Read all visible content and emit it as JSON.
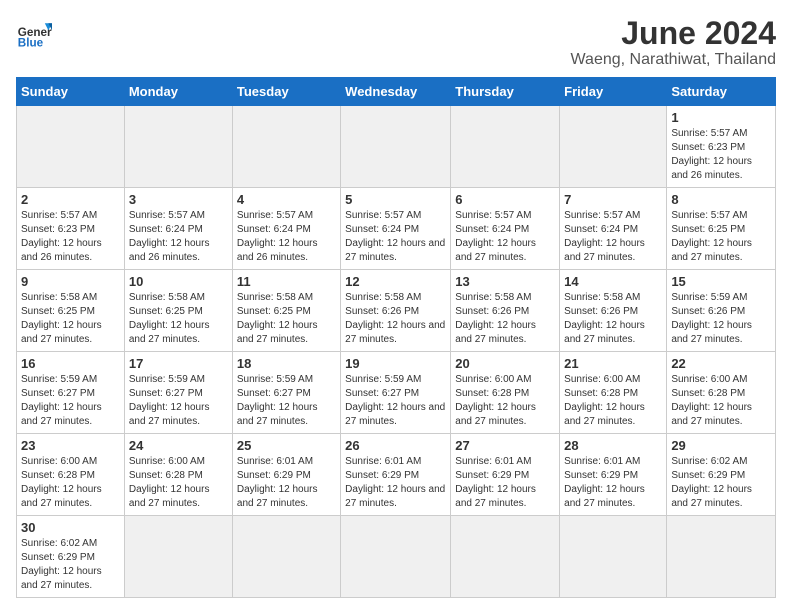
{
  "header": {
    "logo_general": "General",
    "logo_blue": "Blue",
    "title": "June 2024",
    "subtitle": "Waeng, Narathiwat, Thailand"
  },
  "weekdays": [
    "Sunday",
    "Monday",
    "Tuesday",
    "Wednesday",
    "Thursday",
    "Friday",
    "Saturday"
  ],
  "weeks": [
    [
      {
        "date": "",
        "info": ""
      },
      {
        "date": "",
        "info": ""
      },
      {
        "date": "",
        "info": ""
      },
      {
        "date": "",
        "info": ""
      },
      {
        "date": "",
        "info": ""
      },
      {
        "date": "",
        "info": ""
      },
      {
        "date": "1",
        "info": "Sunrise: 5:57 AM\nSunset: 6:23 PM\nDaylight: 12 hours and 26 minutes."
      }
    ],
    [
      {
        "date": "2",
        "info": "Sunrise: 5:57 AM\nSunset: 6:23 PM\nDaylight: 12 hours and 26 minutes."
      },
      {
        "date": "3",
        "info": "Sunrise: 5:57 AM\nSunset: 6:24 PM\nDaylight: 12 hours and 26 minutes."
      },
      {
        "date": "4",
        "info": "Sunrise: 5:57 AM\nSunset: 6:24 PM\nDaylight: 12 hours and 26 minutes."
      },
      {
        "date": "5",
        "info": "Sunrise: 5:57 AM\nSunset: 6:24 PM\nDaylight: 12 hours and 27 minutes."
      },
      {
        "date": "6",
        "info": "Sunrise: 5:57 AM\nSunset: 6:24 PM\nDaylight: 12 hours and 27 minutes."
      },
      {
        "date": "7",
        "info": "Sunrise: 5:57 AM\nSunset: 6:24 PM\nDaylight: 12 hours and 27 minutes."
      },
      {
        "date": "8",
        "info": "Sunrise: 5:57 AM\nSunset: 6:25 PM\nDaylight: 12 hours and 27 minutes."
      }
    ],
    [
      {
        "date": "9",
        "info": "Sunrise: 5:58 AM\nSunset: 6:25 PM\nDaylight: 12 hours and 27 minutes."
      },
      {
        "date": "10",
        "info": "Sunrise: 5:58 AM\nSunset: 6:25 PM\nDaylight: 12 hours and 27 minutes."
      },
      {
        "date": "11",
        "info": "Sunrise: 5:58 AM\nSunset: 6:25 PM\nDaylight: 12 hours and 27 minutes."
      },
      {
        "date": "12",
        "info": "Sunrise: 5:58 AM\nSunset: 6:26 PM\nDaylight: 12 hours and 27 minutes."
      },
      {
        "date": "13",
        "info": "Sunrise: 5:58 AM\nSunset: 6:26 PM\nDaylight: 12 hours and 27 minutes."
      },
      {
        "date": "14",
        "info": "Sunrise: 5:58 AM\nSunset: 6:26 PM\nDaylight: 12 hours and 27 minutes."
      },
      {
        "date": "15",
        "info": "Sunrise: 5:59 AM\nSunset: 6:26 PM\nDaylight: 12 hours and 27 minutes."
      }
    ],
    [
      {
        "date": "16",
        "info": "Sunrise: 5:59 AM\nSunset: 6:27 PM\nDaylight: 12 hours and 27 minutes."
      },
      {
        "date": "17",
        "info": "Sunrise: 5:59 AM\nSunset: 6:27 PM\nDaylight: 12 hours and 27 minutes."
      },
      {
        "date": "18",
        "info": "Sunrise: 5:59 AM\nSunset: 6:27 PM\nDaylight: 12 hours and 27 minutes."
      },
      {
        "date": "19",
        "info": "Sunrise: 5:59 AM\nSunset: 6:27 PM\nDaylight: 12 hours and 27 minutes."
      },
      {
        "date": "20",
        "info": "Sunrise: 6:00 AM\nSunset: 6:28 PM\nDaylight: 12 hours and 27 minutes."
      },
      {
        "date": "21",
        "info": "Sunrise: 6:00 AM\nSunset: 6:28 PM\nDaylight: 12 hours and 27 minutes."
      },
      {
        "date": "22",
        "info": "Sunrise: 6:00 AM\nSunset: 6:28 PM\nDaylight: 12 hours and 27 minutes."
      }
    ],
    [
      {
        "date": "23",
        "info": "Sunrise: 6:00 AM\nSunset: 6:28 PM\nDaylight: 12 hours and 27 minutes."
      },
      {
        "date": "24",
        "info": "Sunrise: 6:00 AM\nSunset: 6:28 PM\nDaylight: 12 hours and 27 minutes."
      },
      {
        "date": "25",
        "info": "Sunrise: 6:01 AM\nSunset: 6:29 PM\nDaylight: 12 hours and 27 minutes."
      },
      {
        "date": "26",
        "info": "Sunrise: 6:01 AM\nSunset: 6:29 PM\nDaylight: 12 hours and 27 minutes."
      },
      {
        "date": "27",
        "info": "Sunrise: 6:01 AM\nSunset: 6:29 PM\nDaylight: 12 hours and 27 minutes."
      },
      {
        "date": "28",
        "info": "Sunrise: 6:01 AM\nSunset: 6:29 PM\nDaylight: 12 hours and 27 minutes."
      },
      {
        "date": "29",
        "info": "Sunrise: 6:02 AM\nSunset: 6:29 PM\nDaylight: 12 hours and 27 minutes."
      }
    ],
    [
      {
        "date": "30",
        "info": "Sunrise: 6:02 AM\nSunset: 6:29 PM\nDaylight: 12 hours and 27 minutes."
      },
      {
        "date": "",
        "info": ""
      },
      {
        "date": "",
        "info": ""
      },
      {
        "date": "",
        "info": ""
      },
      {
        "date": "",
        "info": ""
      },
      {
        "date": "",
        "info": ""
      },
      {
        "date": "",
        "info": ""
      }
    ]
  ]
}
